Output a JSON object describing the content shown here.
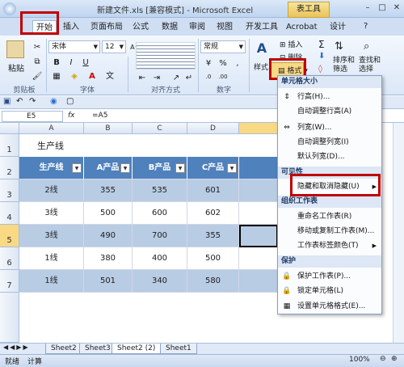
{
  "window": {
    "title": "新建文件.xls [兼容模式] - Microsoft Excel",
    "context_tab": "表工具",
    "min": "–",
    "max": "□",
    "close": "✕"
  },
  "tabs": [
    "开始",
    "插入",
    "页面布局",
    "公式",
    "数据",
    "审阅",
    "视图",
    "开发工具",
    "Acrobat",
    "设计"
  ],
  "ribbon": {
    "paste": "粘贴",
    "font_name": "宋体",
    "font_size": "12",
    "number_format": "常规",
    "style": "样式",
    "insert": "插入",
    "delete": "删除",
    "format": "格式",
    "sort_filter": "排序和筛选",
    "find_select": "查找和选择",
    "groups": [
      "剪贴板",
      "字体",
      "对齐方式",
      "数字"
    ]
  },
  "formula_bar": {
    "name_box": "E5",
    "fx": "fx",
    "formula": "=A5"
  },
  "columns": [
    "A",
    "B",
    "C",
    "D"
  ],
  "rows": [
    "1",
    "2",
    "3",
    "4",
    "5",
    "6",
    "7"
  ],
  "sheet": {
    "title": "生产线",
    "headers": [
      "生产线",
      "A产品",
      "B产品",
      "C产品"
    ],
    "data": [
      [
        "2线",
        "355",
        "535",
        "601"
      ],
      [
        "3线",
        "500",
        "600",
        "602"
      ],
      [
        "3线",
        "490",
        "700",
        "355"
      ],
      [
        "1线",
        "380",
        "400",
        "500"
      ],
      [
        "1线",
        "501",
        "340",
        "580"
      ]
    ]
  },
  "menu": {
    "cell_size": "单元格大小",
    "row_height": "行高(H)...",
    "autofit_row": "自动调整行高(A)",
    "col_width": "列宽(W)...",
    "autofit_col": "自动调整列宽(I)",
    "default_width": "默认列宽(D)...",
    "visibility": "可见性",
    "hide_unhide": "隐藏和取消隐藏(U)",
    "organize": "组织工作表",
    "rename": "重命名工作表(R)",
    "move_copy": "移动或复制工作表(M)...",
    "tab_color": "工作表标签颜色(T)",
    "protect": "保护",
    "protect_sheet": "保护工作表(P)...",
    "lock_cell": "锁定单元格(L)",
    "format_cells": "设置单元格格式(E)..."
  },
  "sheets": [
    "Sheet2",
    "Sheet3",
    "Sheet2 (2)",
    "Sheet1"
  ],
  "status": {
    "ready": "就绪",
    "calc": "计算",
    "zoom": "100%"
  },
  "colors": {
    "accent": "#4f81bd",
    "band": "#b8cce4",
    "highlight": "#c00000"
  }
}
